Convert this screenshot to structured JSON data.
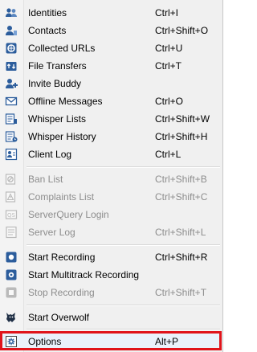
{
  "menu": {
    "items": [
      {
        "label": "Identities",
        "shortcut": "Ctrl+I",
        "icon": "identities-icon",
        "enabled": true
      },
      {
        "label": "Contacts",
        "shortcut": "Ctrl+Shift+O",
        "icon": "contacts-icon",
        "enabled": true
      },
      {
        "label": "Collected URLs",
        "shortcut": "Ctrl+U",
        "icon": "urls-icon",
        "enabled": true
      },
      {
        "label": "File Transfers",
        "shortcut": "Ctrl+T",
        "icon": "file-transfer-icon",
        "enabled": true
      },
      {
        "label": "Invite Buddy",
        "shortcut": "",
        "icon": "invite-buddy-icon",
        "enabled": true
      },
      {
        "label": "Offline Messages",
        "shortcut": "Ctrl+O",
        "icon": "envelope-icon",
        "enabled": true
      },
      {
        "label": "Whisper Lists",
        "shortcut": "Ctrl+Shift+W",
        "icon": "whisper-lists-icon",
        "enabled": true
      },
      {
        "label": "Whisper History",
        "shortcut": "Ctrl+Shift+H",
        "icon": "whisper-history-icon",
        "enabled": true
      },
      {
        "label": "Client Log",
        "shortcut": "Ctrl+L",
        "icon": "client-log-icon",
        "enabled": true
      },
      {
        "label": "Ban List",
        "shortcut": "Ctrl+Shift+B",
        "icon": "ban-list-icon",
        "enabled": false
      },
      {
        "label": "Complaints List",
        "shortcut": "Ctrl+Shift+C",
        "icon": "complaints-icon",
        "enabled": false
      },
      {
        "label": "ServerQuery Login",
        "shortcut": "",
        "icon": "serverquery-icon",
        "enabled": false
      },
      {
        "label": "Server Log",
        "shortcut": "Ctrl+Shift+L",
        "icon": "server-log-icon",
        "enabled": false
      },
      {
        "label": "Start Recording",
        "shortcut": "Ctrl+Shift+R",
        "icon": "record-icon",
        "enabled": true
      },
      {
        "label": "Start Multitrack Recording",
        "shortcut": "",
        "icon": "multitrack-record-icon",
        "enabled": true
      },
      {
        "label": "Stop Recording",
        "shortcut": "Ctrl+Shift+T",
        "icon": "stop-record-icon",
        "enabled": false
      },
      {
        "label": "Start Overwolf",
        "shortcut": "",
        "icon": "overwolf-icon",
        "enabled": true
      },
      {
        "label": "Options",
        "shortcut": "Alt+P",
        "icon": "options-icon",
        "enabled": true
      }
    ]
  },
  "colors": {
    "highlight_border": "#e0141b",
    "icon_blue": "#2c5d9c",
    "disabled_text": "#8d8d8d"
  }
}
